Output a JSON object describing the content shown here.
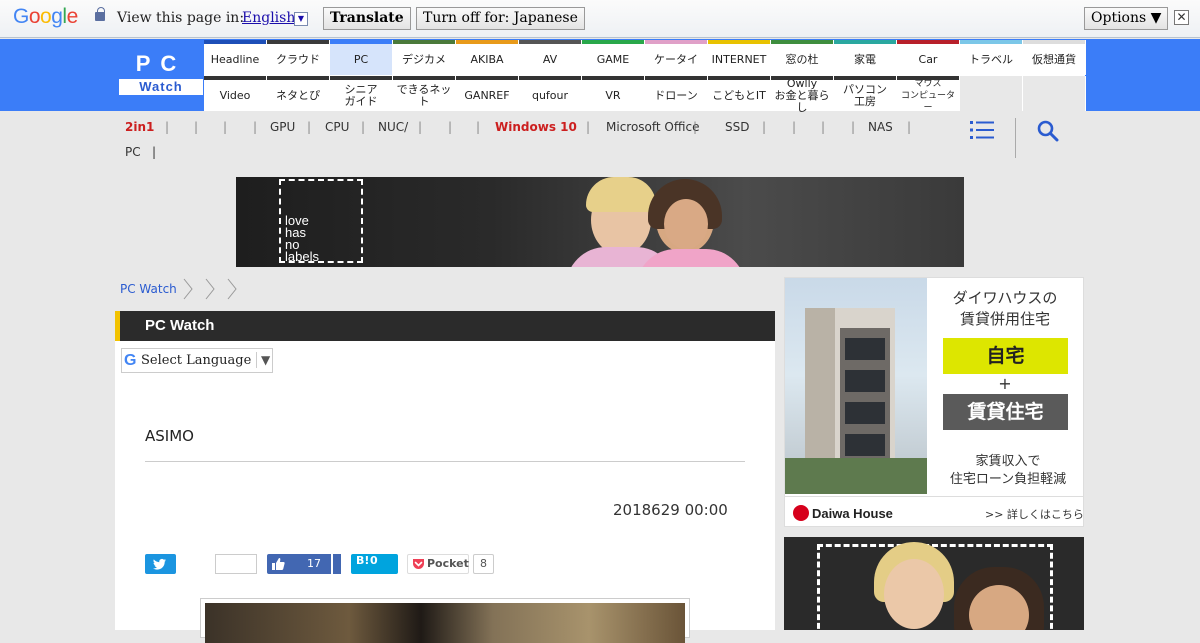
{
  "translate_bar": {
    "logo_letters": [
      {
        "ch": "G",
        "color": "#4285f4"
      },
      {
        "ch": "o",
        "color": "#ea4335"
      },
      {
        "ch": "o",
        "color": "#fbbc05"
      },
      {
        "ch": "g",
        "color": "#4285f4"
      },
      {
        "ch": "l",
        "color": "#34a853"
      },
      {
        "ch": "e",
        "color": "#ea4335"
      }
    ],
    "view_label": "View this page in:",
    "language": "English",
    "translate_button": "Translate",
    "turn_off_button": "Turn off for: Japanese",
    "options_button": "Options ▼",
    "close_glyph": "✕"
  },
  "site": {
    "logo_top": "PC",
    "logo_bottom": "Watch"
  },
  "nav": {
    "row1": [
      {
        "label": "Headline",
        "color": "#1d4fb8"
      },
      {
        "label": "クラウド",
        "color": "#3a3a3a"
      },
      {
        "label": "PC",
        "color": "#3b7df8",
        "active": true
      },
      {
        "label": "デジカメ",
        "color": "#4a7a3a"
      },
      {
        "label": "AKIBA",
        "color": "#e89a1a"
      },
      {
        "label": "AV",
        "color": "#555555"
      },
      {
        "label": "GAME",
        "color": "#29a84a"
      },
      {
        "label": "ケータイ",
        "color": "#e0a0c8"
      },
      {
        "label": "INTERNET",
        "color": "#e8c200"
      },
      {
        "label": "窓の杜",
        "color": "#3e8e3e"
      },
      {
        "label": "家電",
        "color": "#2aa8a0"
      },
      {
        "label": "Car",
        "color": "#b8202a"
      },
      {
        "label": "トラベル",
        "color": "#7bc7e8"
      },
      {
        "label": "仮想通貨",
        "color": "#dddddd"
      }
    ],
    "row2": [
      {
        "label": "Video",
        "color": "#333333"
      },
      {
        "label": "ネタとぴ",
        "color": "#333333"
      },
      {
        "label": "シニア\nガイド",
        "color": "#333333"
      },
      {
        "label": "できるネット",
        "color": "#333333"
      },
      {
        "label": "GANREF",
        "color": "#333333"
      },
      {
        "label": "qufour",
        "color": "#333333"
      },
      {
        "label": "VR",
        "color": "#333333"
      },
      {
        "label": "ドローン",
        "color": "#333333"
      },
      {
        "label": "こどもとIT",
        "color": "#333333"
      },
      {
        "label": "Owlly\nお金と暮らし",
        "color": "#333333"
      },
      {
        "label": "パソコン\n工房",
        "color": "#333333"
      },
      {
        "label": "マウス\nコンピューター",
        "color": "#333333",
        "small": true
      }
    ]
  },
  "subnav": {
    "items": [
      {
        "label": "2in1",
        "red": true
      },
      {
        "label": "|"
      },
      {
        "label": "|"
      },
      {
        "label": "|"
      },
      {
        "label": "|"
      },
      {
        "label": "GPU"
      },
      {
        "label": "|"
      },
      {
        "label": "CPU"
      },
      {
        "label": "|"
      },
      {
        "label": "NUC/"
      },
      {
        "label": "|"
      },
      {
        "label": "|"
      },
      {
        "label": "|"
      },
      {
        "label": "Windows 10",
        "red": true
      },
      {
        "label": "|"
      },
      {
        "label": "Microsoft Office"
      },
      {
        "label": "|"
      },
      {
        "label": "SSD"
      },
      {
        "label": "|"
      },
      {
        "label": "|"
      },
      {
        "label": "|"
      },
      {
        "label": "|"
      },
      {
        "label": "NAS"
      },
      {
        "label": "|"
      }
    ],
    "second_line": "PC   |"
  },
  "banner": {
    "tagline": "love\nhas\nno\nlabels"
  },
  "breadcrumb": {
    "home": "PC Watch"
  },
  "main": {
    "section_title": "PC Watch",
    "language_select": "Select Language",
    "language_g": "G",
    "language_arrow": "▼",
    "article_title": "ASIMO",
    "date": "2018629 00:00",
    "share": {
      "facebook_count": "17",
      "hatena_label": "B!",
      "hatena_count": "0",
      "pocket_label": "Pocket",
      "pocket_count": "8"
    }
  },
  "ad_daiwa": {
    "headline": "ダイワハウスの\n賃貸併用住宅",
    "option1": "自宅",
    "plus": "+",
    "option2": "賃貸住宅",
    "subline": "家賃収入で\n住宅ローン負担軽減",
    "brand": "Daiwa House",
    "more": ">> 詳しくはこちら"
  }
}
